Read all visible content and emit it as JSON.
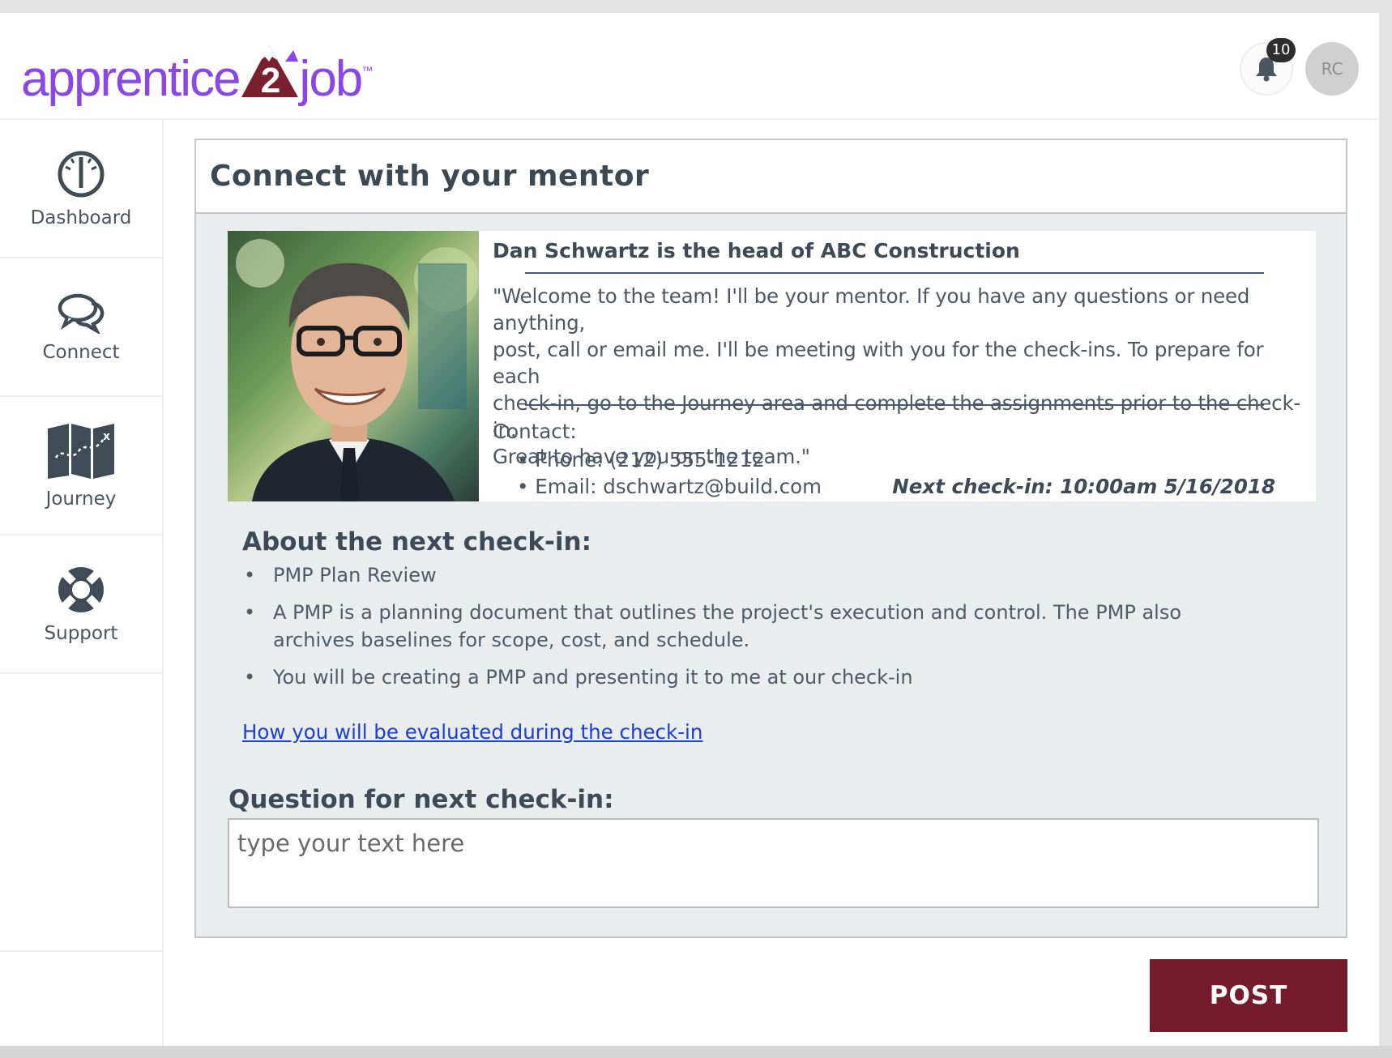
{
  "brand": {
    "logo_part1": "apprentice",
    "logo_number": "2",
    "logo_part2": "job",
    "logo_tm": "™",
    "purple": "#8a46e6",
    "maroon": "#761b2c"
  },
  "header": {
    "notification_count": "10",
    "avatar_initials": "RC"
  },
  "sidebar": {
    "items": [
      {
        "label": "Dashboard",
        "icon": "speedometer-icon"
      },
      {
        "label": "Connect",
        "icon": "chat-bubbles-icon"
      },
      {
        "label": "Journey",
        "icon": "map-icon"
      },
      {
        "label": "Support",
        "icon": "lifebuoy-icon"
      }
    ]
  },
  "main": {
    "title": "Connect with your mentor",
    "mentor": {
      "heading": "Dan Schwartz is the head of ABC Construction",
      "quote_lines": [
        "\"Welcome to the team! I'll be your mentor. If you have any questions or need anything,",
        "post, call or email me. I'll be meeting with you for the check-ins. To prepare for each",
        "check-in, go to the Journey area and complete the assignments prior to the check-in.",
        "Great to have you on the team.\""
      ],
      "contact_label": "Contact:",
      "phone": "Phone: (212) 555-1212",
      "email": "Email: dschwartz@build.com",
      "next_checkin": "Next check-in: 10:00am 5/16/2018"
    },
    "about": {
      "title": "About the next check-in:",
      "items": [
        "PMP Plan Review",
        "A PMP is a planning document that outlines the project's execution and control. The PMP also archives baselines for scope, cost, and schedule.",
        "You will be creating a PMP and presenting it to me at our check-in"
      ],
      "link": "How you will be evaluated during the check-in"
    },
    "question": {
      "label": "Question for next check-in:",
      "placeholder": "type your text here",
      "value": ""
    },
    "post_button": "POST"
  }
}
